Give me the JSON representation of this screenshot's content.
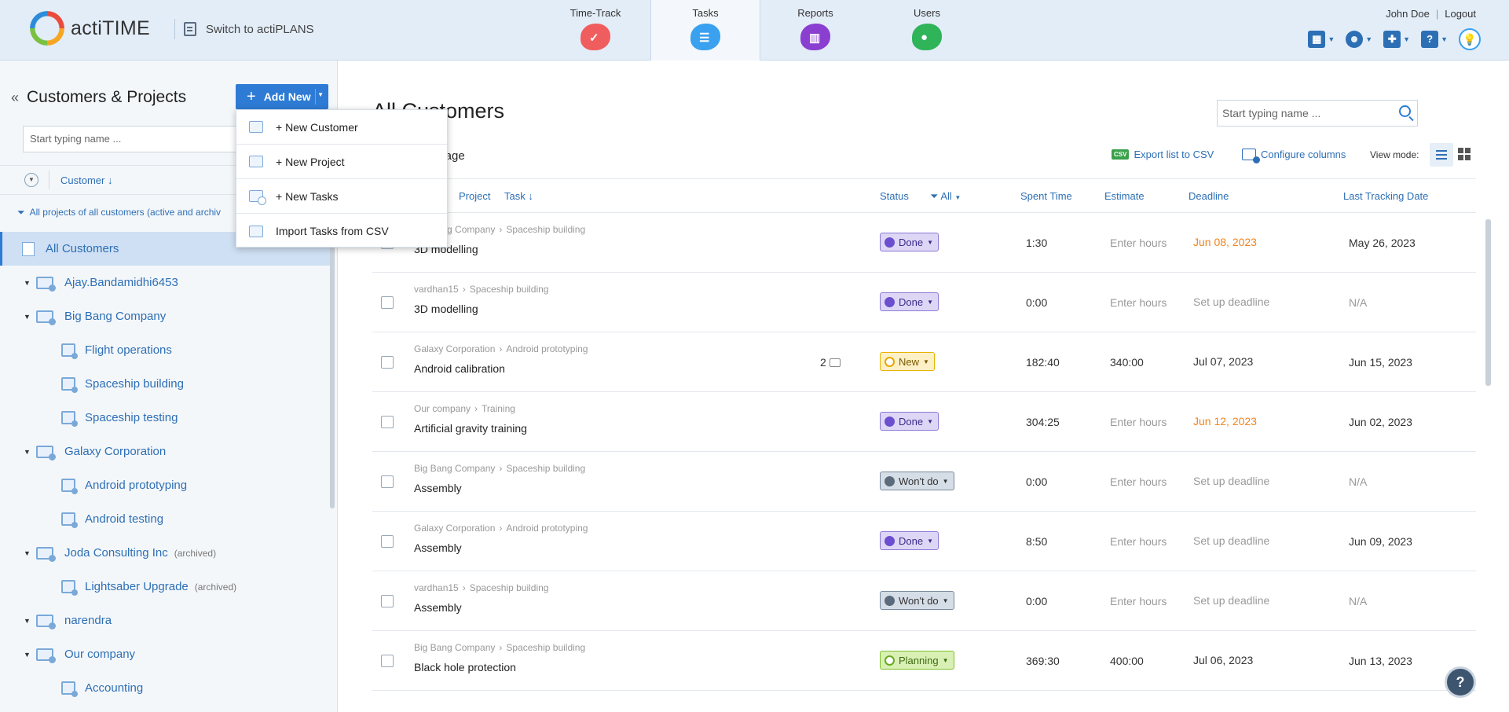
{
  "header": {
    "logo_text": "actiTIME",
    "switch_label": "Switch to actiPLANS",
    "tabs": [
      {
        "label": "Time-Track",
        "icon": "time-track-icon"
      },
      {
        "label": "Tasks",
        "icon": "tasks-icon"
      },
      {
        "label": "Reports",
        "icon": "reports-icon"
      },
      {
        "label": "Users",
        "icon": "users-icon"
      }
    ],
    "user_name": "John Doe",
    "logout": "Logout",
    "help_glyph": "?",
    "bulb_glyph": "💡"
  },
  "left": {
    "title": "Customers & Projects",
    "add_new": "Add New",
    "search_placeholder": "Start typing name ...",
    "sort_label": "Customer ↓",
    "filter_text": "All projects of all customers (active and archiv",
    "tree": [
      {
        "label": "All Customers",
        "type": "all",
        "selected": true
      },
      {
        "label": "Ajay.Bandamidhi6453",
        "type": "customer"
      },
      {
        "label": "Big Bang Company",
        "type": "customer"
      },
      {
        "label": "Flight operations",
        "type": "project"
      },
      {
        "label": "Spaceship building",
        "type": "project"
      },
      {
        "label": "Spaceship testing",
        "type": "project"
      },
      {
        "label": "Galaxy Corporation",
        "type": "customer"
      },
      {
        "label": "Android prototyping",
        "type": "project"
      },
      {
        "label": "Android testing",
        "type": "project"
      },
      {
        "label": "Joda Consulting Inc",
        "type": "customer",
        "tag": "(archived)"
      },
      {
        "label": "Lightsaber Upgrade",
        "type": "project",
        "tag": "(archived)"
      },
      {
        "label": "narendra",
        "type": "customer"
      },
      {
        "label": "Our company",
        "type": "customer"
      },
      {
        "label": "Accounting",
        "type": "project"
      }
    ]
  },
  "dropdown": {
    "items": [
      "+ New Customer",
      "+ New Project",
      "+ New Tasks",
      "Import Tasks from CSV"
    ]
  },
  "main": {
    "title": "All Customers",
    "search_placeholder": "Start typing name ...",
    "manage": "anage",
    "csv_badge": "CSV",
    "export": "Export list to CSV",
    "configure": "Configure columns",
    "view_mode": "View mode:",
    "columns": {
      "customer": "er",
      "project": "Project",
      "task": "Task ↓",
      "status": "Status",
      "status_filter": "All",
      "spent": "Spent Time",
      "estimate": "Estimate",
      "deadline": "Deadline",
      "last": "Last Tracking Date"
    },
    "rows": [
      {
        "customer": "Big Bang Company",
        "project": "Spaceship building",
        "task": "3D modelling",
        "comments": "",
        "status": "Done",
        "status_kind": "done",
        "spent": "1:30",
        "estimate": "Enter hours",
        "deadline": "Jun 08, 2023",
        "deadline_kind": "orange",
        "last": "May 26, 2023"
      },
      {
        "customer": "vardhan15",
        "project": "Spaceship building",
        "task": "3D modelling",
        "comments": "",
        "status": "Done",
        "status_kind": "done",
        "spent": "0:00",
        "estimate": "Enter hours",
        "deadline": "Set up deadline",
        "deadline_kind": "muted",
        "last": "N/A"
      },
      {
        "customer": "Galaxy Corporation",
        "project": "Android prototyping",
        "task": "Android calibration",
        "comments": "2",
        "status": "New",
        "status_kind": "new",
        "spent": "182:40",
        "estimate": "340:00",
        "deadline": "Jul 07, 2023",
        "deadline_kind": "dark",
        "last": "Jun 15, 2023"
      },
      {
        "customer": "Our company",
        "project": "Training",
        "task": "Artificial gravity training",
        "comments": "",
        "status": "Done",
        "status_kind": "done",
        "spent": "304:25",
        "estimate": "Enter hours",
        "deadline": "Jun 12, 2023",
        "deadline_kind": "orange",
        "last": "Jun 02, 2023"
      },
      {
        "customer": "Big Bang Company",
        "project": "Spaceship building",
        "task": "Assembly",
        "comments": "",
        "status": "Won't do",
        "status_kind": "wont",
        "spent": "0:00",
        "estimate": "Enter hours",
        "deadline": "Set up deadline",
        "deadline_kind": "muted",
        "last": "N/A"
      },
      {
        "customer": "Galaxy Corporation",
        "project": "Android prototyping",
        "task": "Assembly",
        "comments": "",
        "status": "Done",
        "status_kind": "done",
        "spent": "8:50",
        "estimate": "Enter hours",
        "deadline": "Set up deadline",
        "deadline_kind": "muted",
        "last": "Jun 09, 2023"
      },
      {
        "customer": "vardhan15",
        "project": "Spaceship building",
        "task": "Assembly",
        "comments": "",
        "status": "Won't do",
        "status_kind": "wont",
        "spent": "0:00",
        "estimate": "Enter hours",
        "deadline": "Set up deadline",
        "deadline_kind": "muted",
        "last": "N/A"
      },
      {
        "customer": "Big Bang Company",
        "project": "Spaceship building",
        "task": "Black hole protection",
        "comments": "",
        "status": "Planning",
        "status_kind": "plan",
        "spent": "369:30",
        "estimate": "400:00",
        "deadline": "Jul 06, 2023",
        "deadline_kind": "dark",
        "last": "Jun 13, 2023"
      }
    ],
    "help_fab": "?"
  }
}
